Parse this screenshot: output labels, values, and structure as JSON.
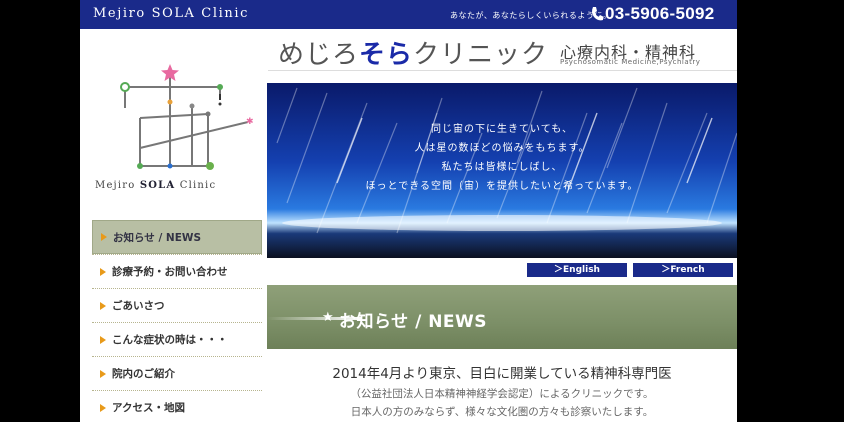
{
  "topbar": {
    "brand": "Mejiro SOLA Clinic",
    "tagline": "あなたが、あなたらしくいられるように。",
    "phone": "03-5906-5092"
  },
  "logo": {
    "text_prefix": "Mejiro ",
    "text_bold": "SOLA",
    "text_suffix": " Clinic"
  },
  "header": {
    "name_part1": "めじろ",
    "name_part2": "そら",
    "name_part3": "クリニック",
    "dept": "心療内科・精神科",
    "dept_en": "Psychosomatic Medicine,Psychiatry"
  },
  "hero": {
    "lines": [
      "同じ宙の下に生きていても、",
      "人は星の数ほどの悩みをもちます。",
      "私たちは皆様にしばし、",
      "ほっとできる空間（宙）を提供したいと希っています。"
    ]
  },
  "lang": {
    "english": "＞English",
    "french": "＞French"
  },
  "nav": {
    "items": [
      {
        "label": "お知らせ / NEWS",
        "active": true
      },
      {
        "label": "診療予約・お問い合わせ",
        "active": false
      },
      {
        "label": "ごあいさつ",
        "active": false
      },
      {
        "label": "こんな症状の時は・・・",
        "active": false
      },
      {
        "label": "院内のご紹介",
        "active": false
      },
      {
        "label": "アクセス・地図",
        "active": false
      }
    ]
  },
  "news": {
    "title": "お知らせ / NEWS"
  },
  "intro": {
    "line1": "2014年4月より東京、目白に開業している精神科専門医",
    "line2": "（公益社団法人日本精神神経学会認定）によるクリニックです。",
    "line3": "日本人の方のみならず、様々な文化圏の方々も診察いたします。"
  },
  "colors": {
    "topbar": "#1a2a8a",
    "accent": "#e89a1a",
    "news_banner": "#7c8f67"
  }
}
